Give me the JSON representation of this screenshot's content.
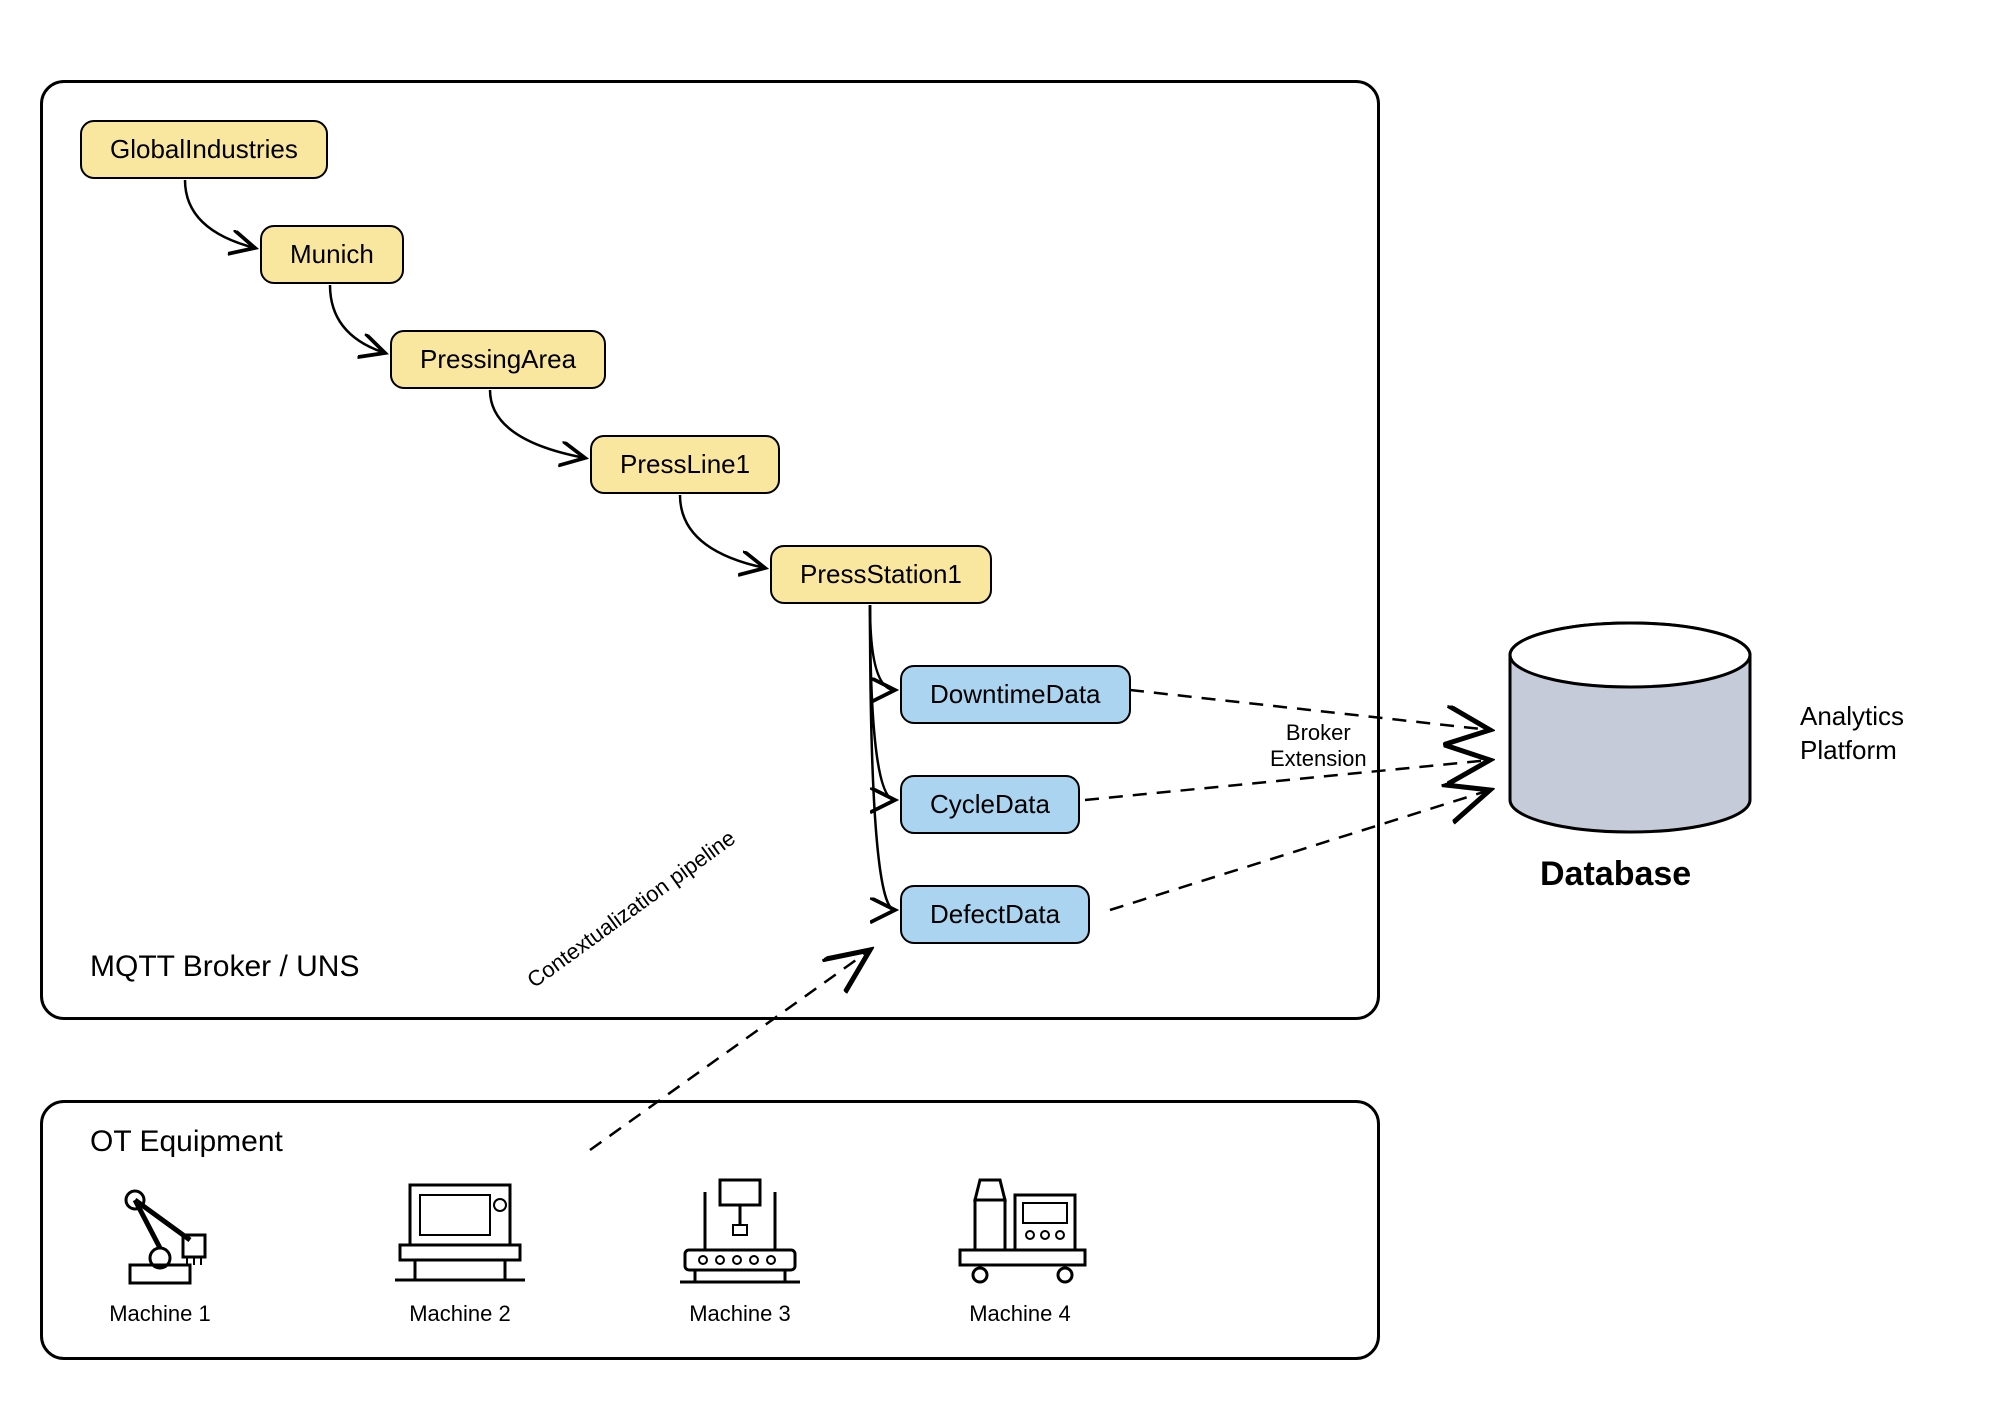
{
  "broker_panel_label": "MQTT Broker / UNS",
  "equipment_panel_label": "OT Equipment",
  "hierarchy": {
    "level0": "GlobalIndustries",
    "level1": "Munich",
    "level2": "PressingArea",
    "level3": "PressLine1",
    "level4": "PressStation1",
    "data0": "DowntimeData",
    "data1": "CycleData",
    "data2": "DefectData"
  },
  "database_label": "Database",
  "analytics_label_line1": "Analytics",
  "analytics_label_line2": "Platform",
  "broker_extension_label_line1": "Broker",
  "broker_extension_label_line2": "Extension",
  "contextualization_label": "Contextualization pipeline",
  "machines": {
    "m1": "Machine 1",
    "m2": "Machine 2",
    "m3": "Machine 3",
    "m4": "Machine 4"
  }
}
